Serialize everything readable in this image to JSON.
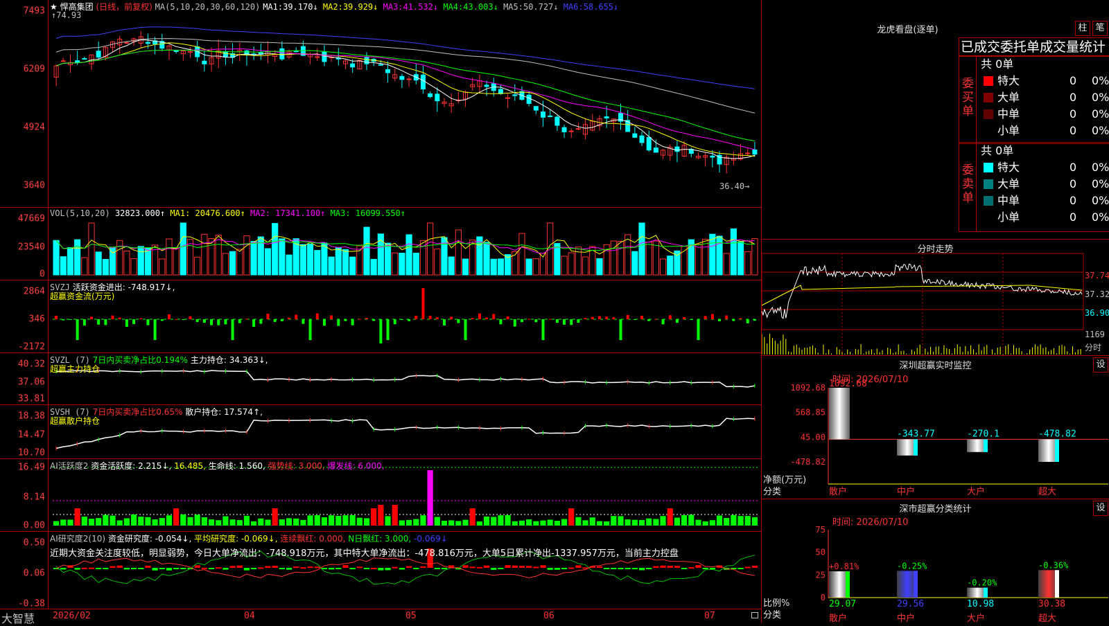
{
  "colors": {
    "up": "#ff3232",
    "down": "#00ffff",
    "red": "#ff0000",
    "green": "#00ff00",
    "yellow": "#ffff00",
    "magenta": "#ff00ff",
    "white": "#ffffff",
    "blue": "#4040ff",
    "gray": "#c0c0c0"
  },
  "main": {
    "y_labels": [
      "7493",
      "6209",
      "4924",
      "3640"
    ],
    "title_star": "★",
    "name": "悍高集团",
    "period": "(日线，前复权)",
    "ma_label": "MA(5,10,20,30,60,120)",
    "ma": [
      {
        "name": "MA1:",
        "value": "39.170↓"
      },
      {
        "name": "MA2:",
        "value": "39.929↓"
      },
      {
        "name": "MA3:",
        "value": "41.532↓"
      },
      {
        "name": "MA4:",
        "value": "43.003↓"
      },
      {
        "name": "MA5:",
        "value": "50.727↓"
      },
      {
        "name": "MA6:",
        "value": "58.655↓"
      }
    ],
    "high_label": "74.93",
    "low_label": "36.40"
  },
  "vol": {
    "y_labels": [
      "47669",
      "23540",
      "0"
    ],
    "label": "VOL(5,10,20)",
    "value": "32823.000↑",
    "ma1": "MA1: 20476.600↑",
    "ma2": "MA2: 17341.100↑",
    "ma3": "MA3: 16099.550↑"
  },
  "svzj": {
    "y_labels": [
      "2864",
      "346",
      "-2172"
    ],
    "label": "SVZJ",
    "text": "活跃资金进出: -748.917↓,",
    "sub": "超赢资金流(万元)"
  },
  "svzl": {
    "y_labels": [
      "40.32",
      "37.06",
      "33.81"
    ],
    "label": "SVZL (7)",
    "pct": "7日内买卖净占比0.194%",
    "hold": "主力持仓: 34.363↓,",
    "sub": "超赢主力持仓"
  },
  "svsh": {
    "y_labels": [
      "18.38",
      "14.47",
      "10.70"
    ],
    "label": "SVSH (7)",
    "pct": "7日内买卖净占比0.65%",
    "hold": "散户持仓: 17.574↑,",
    "sub": "超赢散户持仓"
  },
  "ai1": {
    "y_labels": [
      "16.49",
      "8.14",
      "0.00"
    ],
    "label": "AI活跃度2",
    "act": "资金活跃度: 2.215↓,",
    "act2": "16.485,",
    "life": "生命线: 1.560,",
    "strong": "强势线: 3.000,",
    "burst": "爆发线: 6.000,"
  },
  "ai2": {
    "y_labels": [
      "0.50",
      "0.06",
      "-0.38"
    ],
    "label": "AI研究度2(10)",
    "res": "资金研究度: -0.054↓,",
    "avg": "平均研究度: -0.069↓,",
    "cont": "连续飘红: 0.000,",
    "nday": "N日飘红: 3.000,",
    "extra": "-0.069↓",
    "comment": "近期大资金关注度较低，明显弱势，今日大单净流出：-748.918万元，其中特大单净流出：-478.816万元，大单5日累计净出-1337.957万元，当前主力控盘"
  },
  "xaxis": {
    "brand": "大智慧",
    "dates": [
      "2026/02",
      "04",
      "05",
      "06",
      "07"
    ]
  },
  "longhu": {
    "title": "龙虎看盘(逐单)",
    "btn1": "柱",
    "btn2": "笔",
    "stat_title": "已成交委托单成交量统计",
    "buy": {
      "label": "委买单",
      "total": "共 0单",
      "rows": [
        {
          "name": "特大",
          "v": "0",
          "p": "0%"
        },
        {
          "name": "大单",
          "v": "0",
          "p": "0%"
        },
        {
          "name": "中单",
          "v": "0",
          "p": "0%"
        },
        {
          "name": "小单",
          "v": "0",
          "p": "0%"
        }
      ]
    },
    "sell": {
      "label": "委卖单",
      "total": "共 0单",
      "rows": [
        {
          "name": "特大",
          "v": "0",
          "p": "0%"
        },
        {
          "name": "大单",
          "v": "0",
          "p": "0%"
        },
        {
          "name": "中单",
          "v": "0",
          "p": "0%"
        },
        {
          "name": "小单",
          "v": "0",
          "p": "0%"
        }
      ]
    }
  },
  "fenshi": {
    "title": "分时走势",
    "prices": [
      "37.74",
      "37.32",
      "36.90"
    ],
    "vol": "1169",
    "vol_unit": "分时"
  },
  "monitor": {
    "title": "深圳超赢实时监控",
    "btn": "设",
    "time": "时间: 2026/07/10",
    "y_labels": [
      "1092.68",
      "568.85",
      "45.00",
      "-478.82"
    ],
    "ylabel": "净额(万元)",
    "xlabel": "分类",
    "bars": [
      {
        "cat": "散户",
        "value": 1092.68,
        "label": "1092.68"
      },
      {
        "cat": "中户",
        "value": -343.77,
        "label": "-343.77"
      },
      {
        "cat": "大户",
        "value": -270.1,
        "label": "-270.1"
      },
      {
        "cat": "超大",
        "value": -478.82,
        "label": "-478.82"
      }
    ]
  },
  "classify": {
    "title": "深市超赢分类统计",
    "btn": "设",
    "time": "时间: 2026/07/10",
    "y_labels": [
      "75",
      "50",
      "25",
      "0"
    ],
    "ylabel": "比例%",
    "xlabel": "分类",
    "bars": [
      {
        "cat": "散户",
        "value": 29.07,
        "pct": "+0.81%"
      },
      {
        "cat": "中户",
        "value": 29.56,
        "pct": "-0.25%"
      },
      {
        "cat": "大户",
        "value": 10.98,
        "pct": "-0.20%"
      },
      {
        "cat": "超大",
        "value": 30.38,
        "pct": "-0.36%"
      }
    ]
  },
  "chart_data": [
    {
      "type": "bar",
      "title": "",
      "categories": [
        "散户",
        "中户",
        "大户",
        "超大"
      ],
      "values": [
        1092.68,
        -343.77,
        -270.1,
        -478.82
      ],
      "ylabel": "净额(万元)",
      "xlabel": "分类",
      "ylim": [
        -478.82,
        1092.68
      ]
    },
    {
      "type": "bar",
      "title": "",
      "categories": [
        "散户",
        "中户",
        "大户",
        "超大"
      ],
      "values": [
        29.07,
        29.56,
        10.98,
        30.38
      ],
      "ylabel": "比例%",
      "xlabel": "分类",
      "ylim": [
        0,
        75
      ]
    }
  ]
}
